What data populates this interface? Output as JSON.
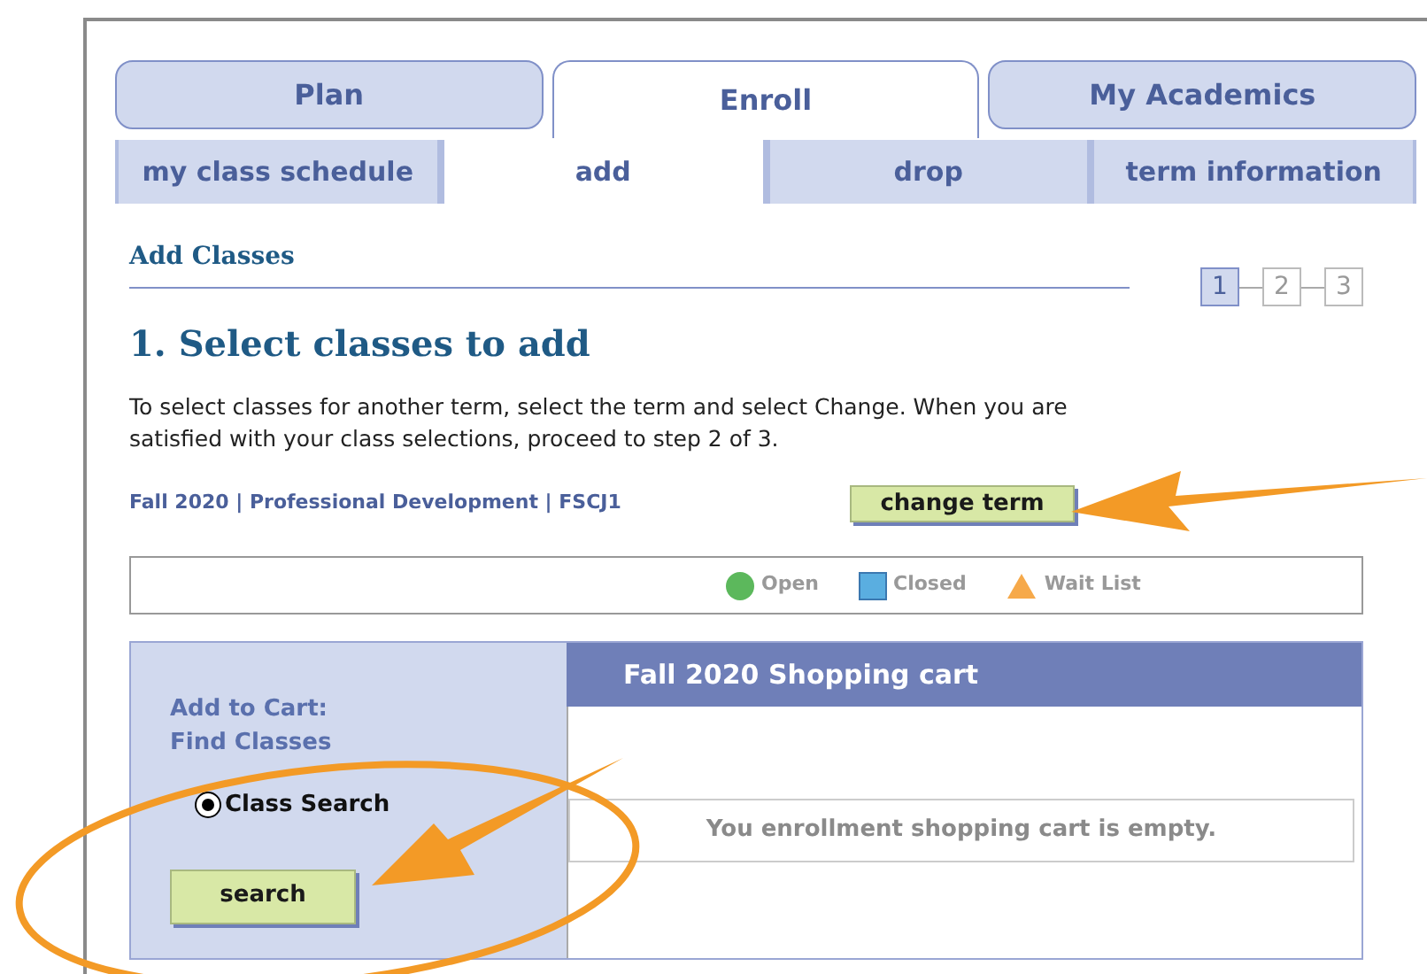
{
  "main_tabs": [
    {
      "label": "Plan",
      "selected": false
    },
    {
      "label": "Enroll",
      "selected": true
    },
    {
      "label": "My Academics",
      "selected": false
    }
  ],
  "sub_tabs": [
    {
      "label": "my class schedule",
      "selected": false
    },
    {
      "label": "add",
      "selected": true
    },
    {
      "label": "drop",
      "selected": false
    },
    {
      "label": "term information",
      "selected": false
    }
  ],
  "section_title": "Add Classes",
  "steps": [
    {
      "label": "1",
      "selected": true
    },
    {
      "label": "2",
      "selected": false
    },
    {
      "label": "3",
      "selected": false
    }
  ],
  "heading": "1. Select classes to add",
  "instructions": "To select classes for another term, select the term and select Change.  When you are satisfied with your class selections, proceed to step 2 of 3.",
  "term": "Fall 2020 | Professional Development | FSCJ1",
  "change_term_button": "change term",
  "legend": [
    {
      "kind": "circle",
      "label": "Open",
      "color": "#5cb85c"
    },
    {
      "kind": "square",
      "label": "Closed",
      "color": "#5aaee0"
    },
    {
      "kind": "triangle",
      "label": "Wait List",
      "color": "#f6a94a"
    }
  ],
  "add_to_cart": {
    "title": "Add to Cart:",
    "subtitle": "Find Classes",
    "option": {
      "label": "Class Search",
      "checked": true
    },
    "button": "search"
  },
  "cart": {
    "title": "Fall 2020 Shopping cart",
    "message": "You enrollment shopping cart is empty."
  }
}
